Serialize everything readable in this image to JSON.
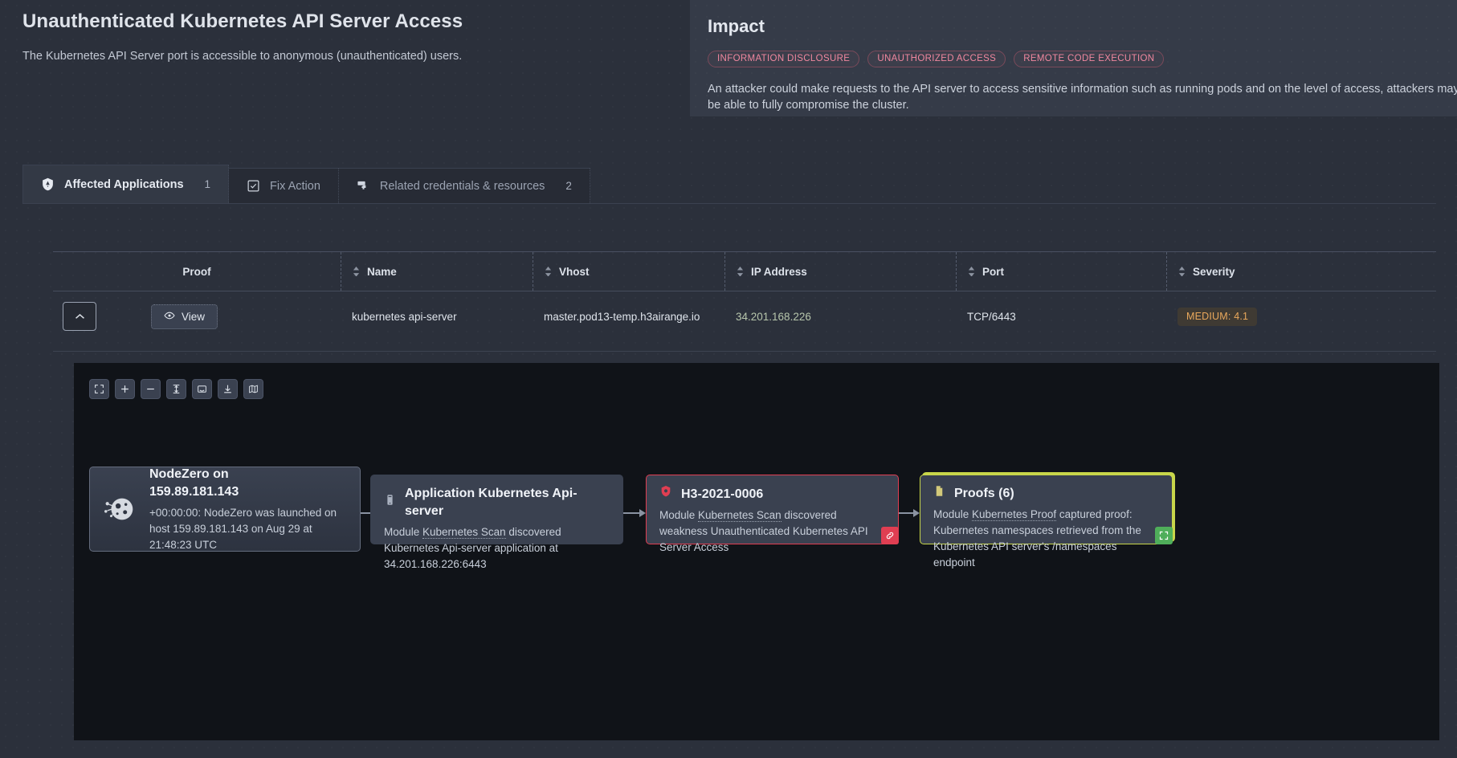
{
  "header": {
    "title": "Unauthenticated Kubernetes API Server Access",
    "subtitle": "The Kubernetes API Server port is accessible to anonymous (unauthenticated) users."
  },
  "impact": {
    "title": "Impact",
    "tags": [
      "INFORMATION DISCLOSURE",
      "UNAUTHORIZED ACCESS",
      "REMOTE CODE EXECUTION"
    ],
    "description": "An attacker could make requests to the API server to access sensitive information such as running pods and on the level of access, attackers may be able to fully compromise the cluster."
  },
  "tabs": [
    {
      "label": "Affected Applications",
      "count": "1",
      "icon": "shield-warning-icon",
      "active": true
    },
    {
      "label": "Fix Action",
      "count": "",
      "icon": "checkbox-icon",
      "active": false
    },
    {
      "label": "Related credentials & resources",
      "count": "2",
      "icon": "key-icon",
      "active": false
    }
  ],
  "table": {
    "columns": [
      {
        "label": "Proof",
        "sortable": false
      },
      {
        "label": "Name",
        "sortable": true
      },
      {
        "label": "Vhost",
        "sortable": true
      },
      {
        "label": "IP Address",
        "sortable": true
      },
      {
        "label": "Port",
        "sortable": true
      },
      {
        "label": "Severity",
        "sortable": true
      }
    ],
    "row": {
      "expand_icon": "chevron-up-icon",
      "view_label": "View",
      "view_icon": "eye-icon",
      "name": "kubernetes api-server",
      "vhost": "master.pod13-temp.h3airange.io",
      "ip_address": "34.201.168.226",
      "port": "TCP/6443",
      "severity": "MEDIUM: 4.1"
    }
  },
  "graph": {
    "toolbar": [
      "fit-screen-icon",
      "zoom-in-icon",
      "zoom-out-icon",
      "fit-height-icon",
      "fit-width-icon",
      "download-icon",
      "minimap-icon"
    ],
    "nodes": [
      {
        "id": "nodezero",
        "icon": "nodezero-logo-icon",
        "title_line1": "NodeZero on",
        "title_line2": "159.89.181.143",
        "body": "+00:00:00: NodeZero was launched on host 159.89.181.143 on Aug 29 at 21:48:23 UTC"
      },
      {
        "id": "application",
        "icon": "server-icon",
        "title": "Application Kubernetes Api-server",
        "body_prefix": "Module ",
        "body_link": "Kubernetes Scan",
        "body_suffix": " discovered Kubernetes Api-server application at 34.201.168.226:6443"
      },
      {
        "id": "weakness",
        "icon": "shield-bug-icon",
        "title": "H3-2021-0006",
        "body_prefix": "Module ",
        "body_link": "Kubernetes Scan",
        "body_suffix": " discovered weakness Unauthenticated Kubernetes API Server Access",
        "corner_icon": "link-icon"
      },
      {
        "id": "proofs",
        "icon": "document-icon",
        "title": "Proofs (6)",
        "body_prefix": "Module ",
        "body_link": "Kubernetes Proof",
        "body_suffix": " captured proof: Kubernetes namespaces retrieved from the Kubernetes API server's /namespaces endpoint",
        "corner_icon": "expand-icon"
      }
    ]
  },
  "colors": {
    "accent_pink": "#f0879f",
    "severity_amber": "#e9a85c",
    "weakness_red": "#e03e52",
    "proofs_green": "#c8d64a",
    "ip_green": "#b7c6ac"
  }
}
